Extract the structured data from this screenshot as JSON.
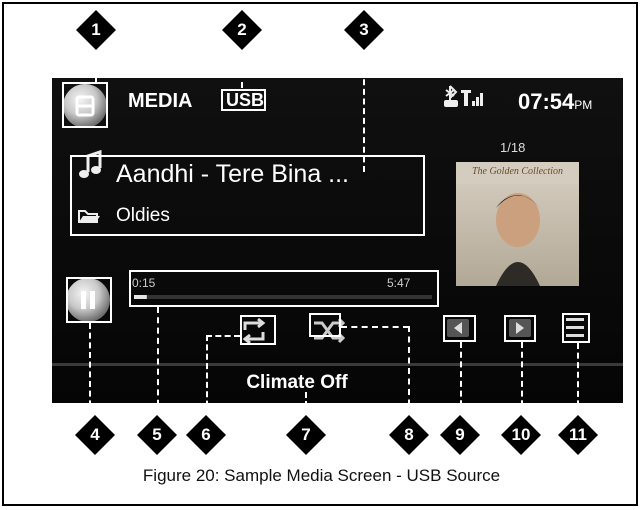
{
  "header": {
    "title": "MEDIA",
    "source": "USB",
    "clock": "07:54",
    "ampm": "PM",
    "icons": [
      "media-source-icon",
      "bluetooth-phone-icon",
      "signal-icon"
    ]
  },
  "track": {
    "title": "Aandhi - Tere Bina ...",
    "folder": "Oldies",
    "counter": "1/18",
    "album_art_text": "The Golden Collection"
  },
  "playback": {
    "elapsed": "0:15",
    "duration": "5:47",
    "progress_fraction": 0.043,
    "play_state": "paused"
  },
  "footer": {
    "climate": "Climate Off"
  },
  "callouts": [
    "1",
    "2",
    "3",
    "4",
    "5",
    "6",
    "7",
    "8",
    "9",
    "10",
    "11"
  ],
  "caption": "Figure 20: Sample Media Screen - USB Source",
  "colors": {
    "screen_bg": "#0b0b0b",
    "callout": "#000000",
    "highlight": "#ffffff"
  }
}
